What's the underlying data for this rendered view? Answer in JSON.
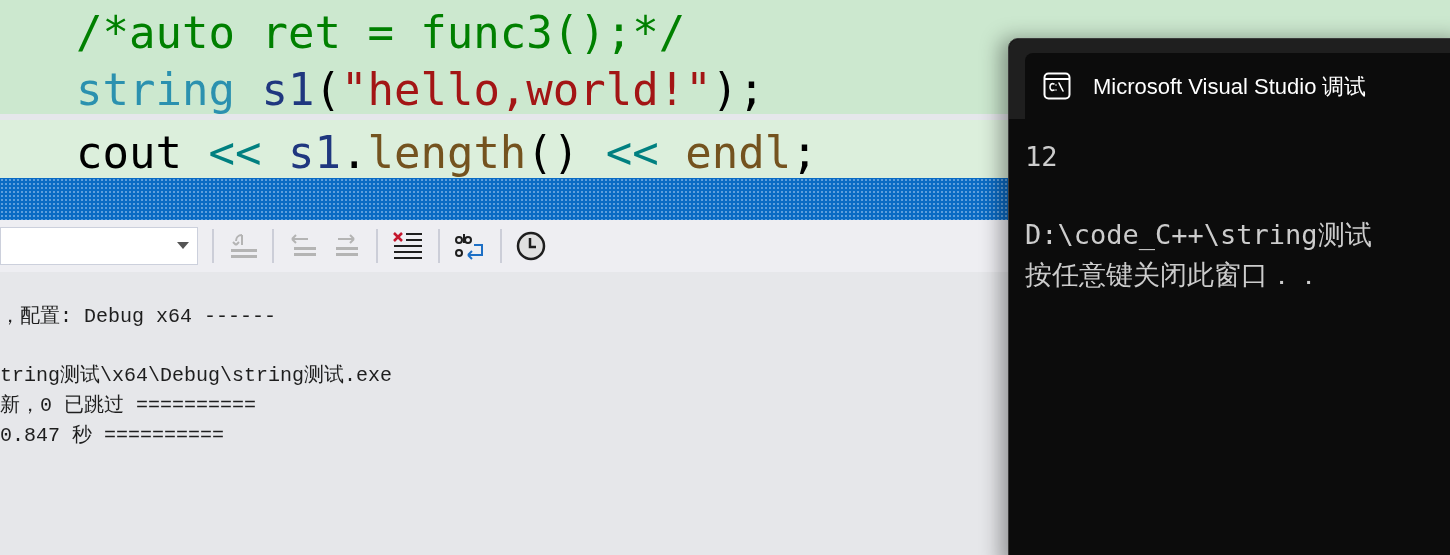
{
  "editor": {
    "lines": [
      {
        "current": false,
        "tokens": [
          {
            "kind": "comment",
            "text": "/*auto ret = func3();*/"
          }
        ]
      },
      {
        "current": false,
        "tokens": [
          {
            "kind": "type",
            "text": "string"
          },
          {
            "kind": "var",
            "text": " s1"
          },
          {
            "kind": "punct",
            "text": "("
          },
          {
            "kind": "string",
            "text": "\"hello,world!\""
          },
          {
            "kind": "punct",
            "text": ");"
          }
        ]
      },
      {
        "current": true,
        "tokens": [
          {
            "kind": "plain",
            "text": "cout"
          },
          {
            "kind": "op",
            "text": " << "
          },
          {
            "kind": "var",
            "text": "s1"
          },
          {
            "kind": "punct",
            "text": "."
          },
          {
            "kind": "func",
            "text": "length"
          },
          {
            "kind": "punct",
            "text": "()"
          },
          {
            "kind": "op",
            "text": " << "
          },
          {
            "kind": "func",
            "text": "endl"
          },
          {
            "kind": "punct",
            "text": ";"
          }
        ]
      }
    ]
  },
  "output": {
    "toolbar": [
      {
        "kind": "goto",
        "disabled": true
      },
      {
        "kind": "prev",
        "disabled": true
      },
      {
        "kind": "next",
        "disabled": true
      },
      {
        "kind": "clear",
        "disabled": false
      },
      {
        "kind": "wrap",
        "disabled": false
      },
      {
        "kind": "clock",
        "disabled": false
      }
    ],
    "blocks": [
      [
        "，配置: Debug x64 ------"
      ],
      [
        "tring测试\\x64\\Debug\\string测试.exe",
        "新，0 已跳过 ==========",
        "0.847 秒 =========="
      ]
    ]
  },
  "console": {
    "title": "Microsoft Visual Studio 调试",
    "blocks": [
      [
        "12"
      ],
      [
        "D:\\code_C++\\string测试",
        "按任意键关闭此窗口．．"
      ]
    ]
  }
}
